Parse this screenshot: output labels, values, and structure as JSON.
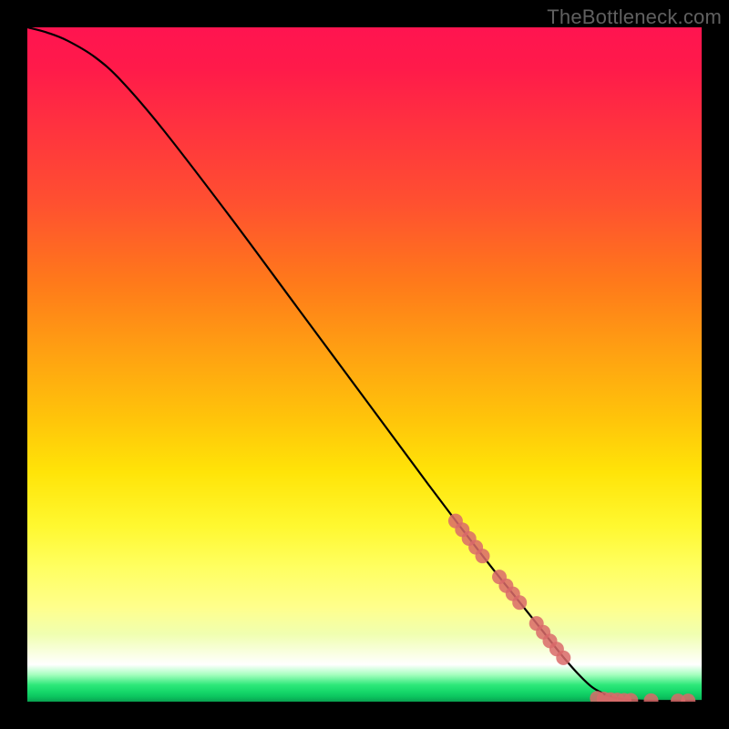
{
  "watermark_text": "TheBottleneck.com",
  "chart_data": {
    "type": "line",
    "title": "",
    "xlabel": "",
    "ylabel": "",
    "xlim": [
      0,
      100
    ],
    "ylim": [
      0,
      100
    ],
    "grid": false,
    "legend": false,
    "curve": [
      {
        "x": 0,
        "y": 100
      },
      {
        "x": 3,
        "y": 99.2
      },
      {
        "x": 6,
        "y": 98.0
      },
      {
        "x": 10,
        "y": 95.6
      },
      {
        "x": 14,
        "y": 92.0
      },
      {
        "x": 20,
        "y": 85.0
      },
      {
        "x": 30,
        "y": 72.0
      },
      {
        "x": 40,
        "y": 58.5
      },
      {
        "x": 50,
        "y": 45.0
      },
      {
        "x": 60,
        "y": 31.5
      },
      {
        "x": 68,
        "y": 21.0
      },
      {
        "x": 72,
        "y": 16.0
      },
      {
        "x": 76,
        "y": 11.0
      },
      {
        "x": 80,
        "y": 6.0
      },
      {
        "x": 83,
        "y": 2.8
      },
      {
        "x": 85,
        "y": 1.4
      },
      {
        "x": 87,
        "y": 0.6
      },
      {
        "x": 90,
        "y": 0.2
      },
      {
        "x": 95,
        "y": 0.1
      },
      {
        "x": 100,
        "y": 0.1
      }
    ],
    "markers": [
      {
        "x": 63.5,
        "y": 26.8
      },
      {
        "x": 64.5,
        "y": 25.5
      },
      {
        "x": 65.5,
        "y": 24.2
      },
      {
        "x": 66.5,
        "y": 22.9
      },
      {
        "x": 67.5,
        "y": 21.6
      },
      {
        "x": 70.0,
        "y": 18.5
      },
      {
        "x": 71.0,
        "y": 17.2
      },
      {
        "x": 72.0,
        "y": 16.0
      },
      {
        "x": 73.0,
        "y": 14.7
      },
      {
        "x": 75.5,
        "y": 11.6
      },
      {
        "x": 76.5,
        "y": 10.3
      },
      {
        "x": 77.5,
        "y": 9.0
      },
      {
        "x": 78.5,
        "y": 7.8
      },
      {
        "x": 79.5,
        "y": 6.5
      },
      {
        "x": 84.5,
        "y": 0.5
      },
      {
        "x": 85.5,
        "y": 0.4
      },
      {
        "x": 86.5,
        "y": 0.3
      },
      {
        "x": 87.5,
        "y": 0.25
      },
      {
        "x": 88.5,
        "y": 0.2
      },
      {
        "x": 89.5,
        "y": 0.2
      },
      {
        "x": 92.5,
        "y": 0.15
      },
      {
        "x": 96.5,
        "y": 0.12
      },
      {
        "x": 98.0,
        "y": 0.12
      }
    ],
    "marker_color": "#d96a6a",
    "marker_radius_px": 8
  }
}
